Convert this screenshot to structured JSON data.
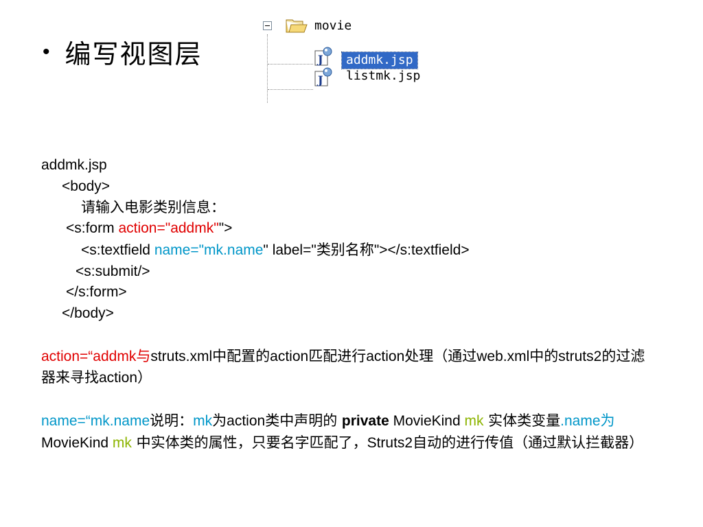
{
  "heading": {
    "bullet": "•",
    "title": "编写视图层"
  },
  "tree": {
    "folder_label": "movie",
    "files": [
      {
        "label": "addmk.jsp",
        "selected": true
      },
      {
        "label": "listmk.jsp",
        "selected": false
      }
    ]
  },
  "code": {
    "filename": "addmk.jsp",
    "body_open": "<body>",
    "prompt": "请输入电影类别信息：",
    "form_open_a": "<s:form ",
    "form_open_b": "action=\"addmk\"",
    "form_open_c": "\">",
    "textfield_a": "<s:textfield ",
    "textfield_b": "name=\"mk.name",
    "textfield_c": "\" label=\"",
    "textfield_d": "类别名称",
    "textfield_e": "\"></s:textfield>",
    "submit": "<s:submit/>",
    "form_close": "</s:form>",
    "body_close": "</body>"
  },
  "note1": {
    "p1": "action=“addmk",
    "p2": "与",
    "p3": "struts.xml",
    "p4": "中配置的",
    "p5": "action",
    "p6": "匹配进行",
    "p7": "action",
    "p8": "处理（通过",
    "p9": "web.xml",
    "p10": "中的",
    "p11": "struts2",
    "p12": "的过滤器来寻找",
    "p13": "action",
    "p14": "）"
  },
  "note2": {
    "p1": "name=“mk.name",
    "p2": "说明：",
    "p3": "mk",
    "p4": "为",
    "p5": "action",
    "p6": "类中声明的 ",
    "p7": "private",
    "p8": " MovieKind ",
    "p9": "mk",
    "p10": " 实体类变量",
    "p11": ".name",
    "p12": "为",
    "p13": "MovieKind ",
    "p14": "mk",
    "p15": " 中实体类的属性，只要名字匹配了，",
    "p16": "Struts2",
    "p17": "自动的进行传值（通过默认拦截器）"
  },
  "colors": {
    "red": "#e00000",
    "teal": "#0096c8",
    "green": "#8cb400",
    "selection": "#3169c6"
  }
}
